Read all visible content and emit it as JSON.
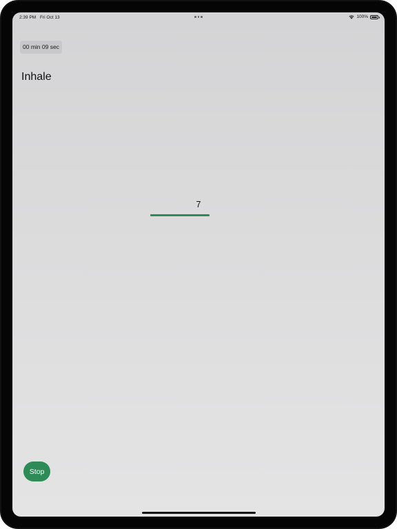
{
  "status_bar": {
    "time": "2:39 PM",
    "date": "Fri Oct 13",
    "battery_percent": "100%",
    "battery_level": 1.0,
    "icons": [
      "multitasking-dots",
      "wifi-icon",
      "battery-icon"
    ]
  },
  "session": {
    "elapsed_label": "00 min 09 sec",
    "phase": "Inhale",
    "count": "7",
    "progress_fraction": 1.0
  },
  "controls": {
    "stop_label": "Stop"
  },
  "colors": {
    "accent": "#2e8a57",
    "background_top": "#d4d4d6",
    "background_bottom": "#e4e4e5",
    "device_frame": "#121212"
  }
}
